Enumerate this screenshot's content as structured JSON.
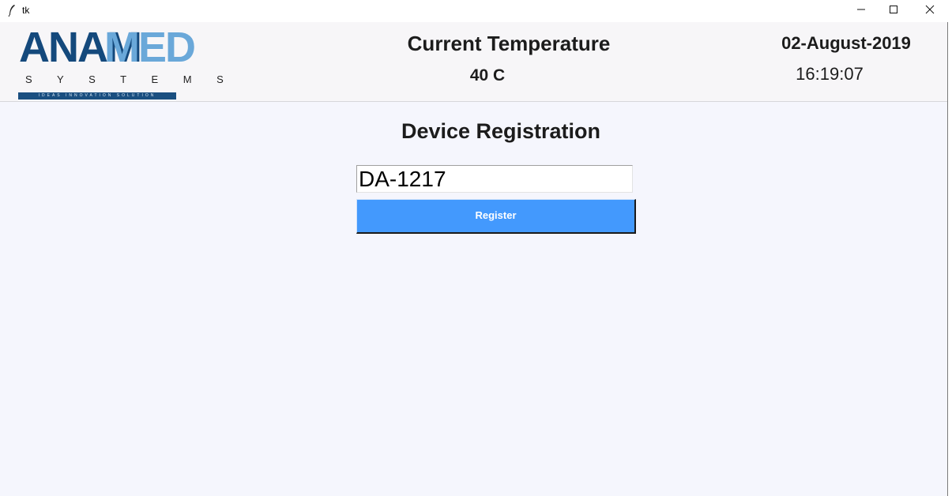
{
  "window": {
    "title": "tk",
    "controls": {
      "minimize": "minimize-icon",
      "maximize": "maximize-icon",
      "close": "close-icon"
    }
  },
  "header": {
    "logo": {
      "main_dark": "ANAM",
      "main_light": "ED",
      "subtitle": "S Y S T E M S",
      "tagline": "IDEAS INNOVATION SOLUTION",
      "colors": {
        "dark": "#14497c",
        "light": "#6aa8d9"
      }
    },
    "temperature_label": "Current Temperature",
    "temperature_value": "40 C",
    "date": "02-August-2019",
    "time": "16:19:07"
  },
  "registration": {
    "title": "Device Registration",
    "device_id_value": "DA-1217",
    "register_label": "Register",
    "button_color": "#4399fd"
  }
}
